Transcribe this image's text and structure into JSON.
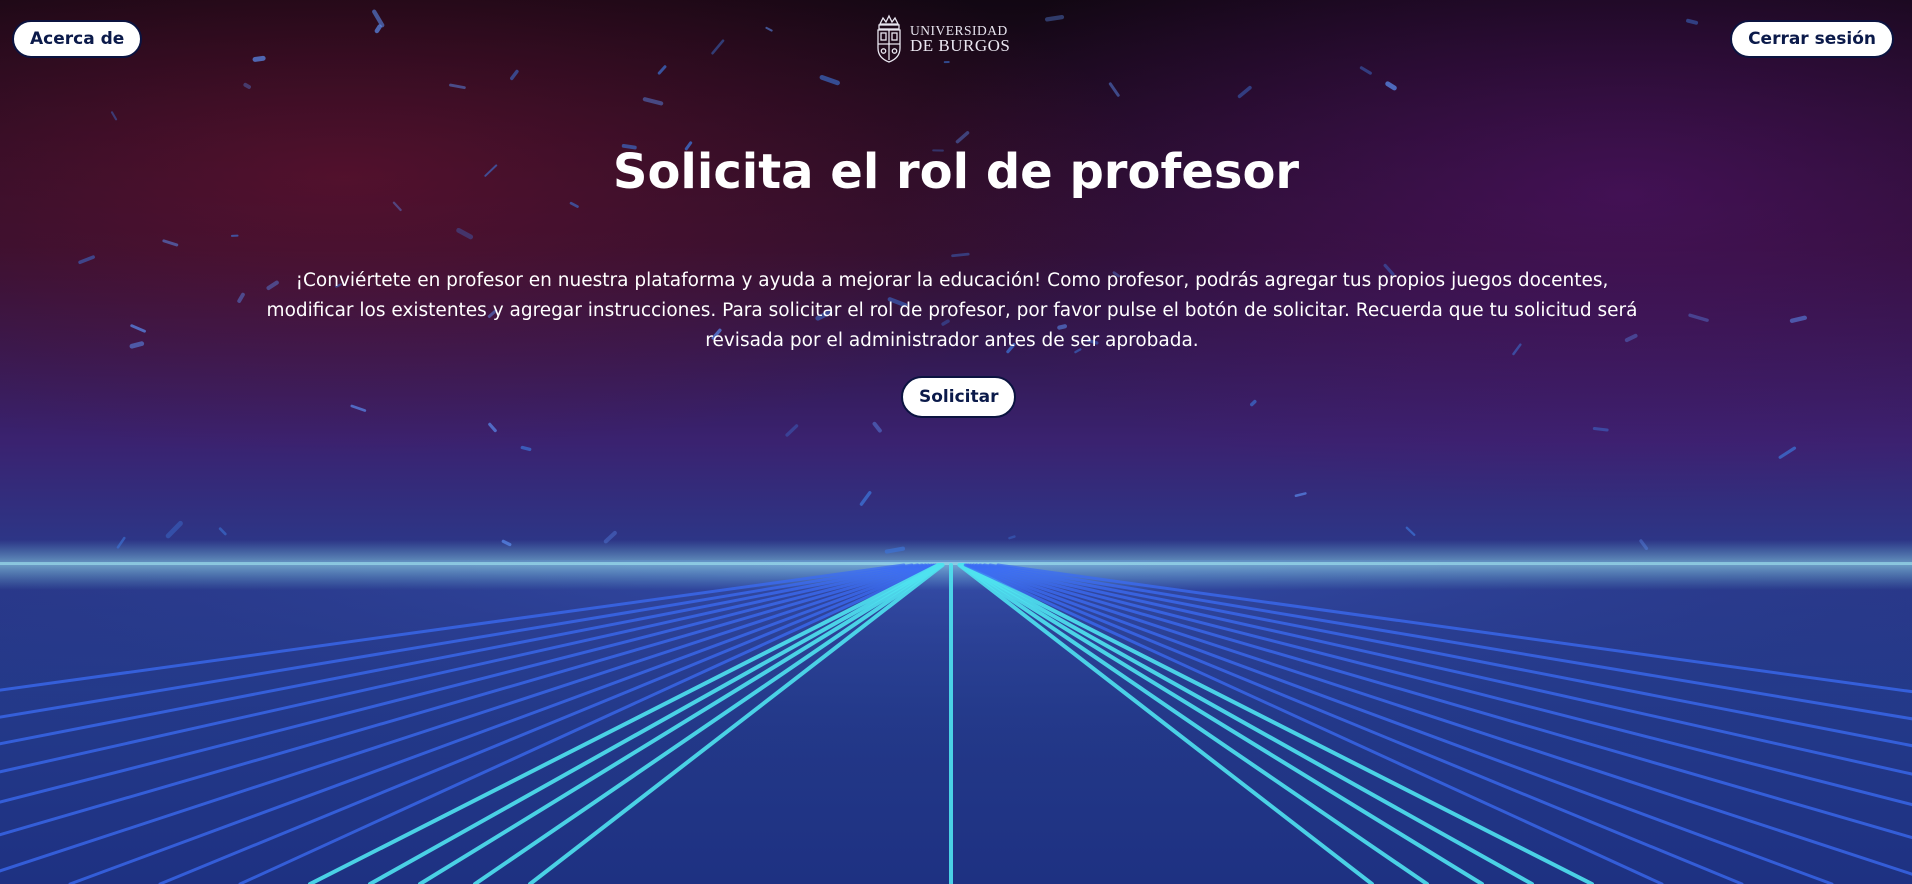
{
  "header": {
    "about_label": "Acerca de",
    "logout_label": "Cerrar sesión",
    "logo": {
      "line1": "UNIVERSIDAD",
      "line2": "DE BURGOS",
      "icon": "university-crest-icon"
    }
  },
  "main": {
    "title": "Solicita el rol de profesor",
    "description": "¡Conviértete en profesor en nuestra plataforma y ayuda a mejorar la educación! Como profesor, podrás agregar tus propios juegos docentes, modificar los existentes y agregar instrucciones. Para solicitar el rol de profesor, por favor pulse el botón de solicitar. Recuerda que tu solicitud será revisada por el administrador antes de ser aprobada.",
    "request_label": "Solicitar"
  },
  "colors": {
    "button_bg": "#ffffff",
    "button_text": "#0b1a4a",
    "accent_cyan": "#4fe3f0",
    "accent_blue": "#3b6cf5"
  }
}
